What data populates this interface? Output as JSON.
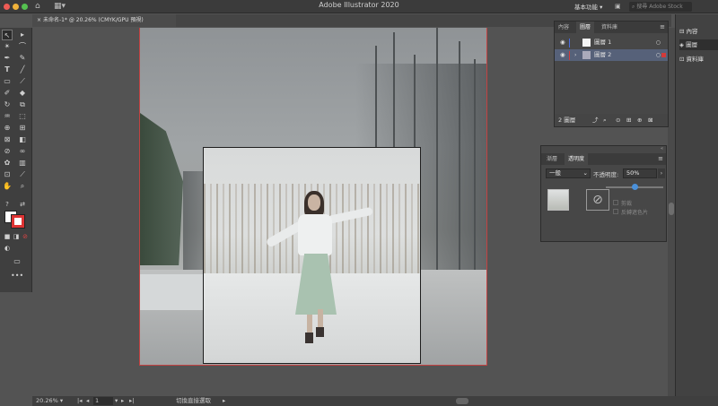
{
  "app": {
    "title": "Adobe Illustrator 2020",
    "workspace": "基本功能",
    "stock_placeholder": "搜尋 Adobe Stock",
    "colors": {
      "selection": "#566179",
      "artboard_border": "#c24242",
      "slider_accent": "#4a90d9"
    }
  },
  "tab": {
    "title": "未命名-1* @ 20.26% (CMYK/GPU 預視)",
    "close": "×"
  },
  "status": {
    "zoom": "20.26%",
    "page": "1",
    "message": "切換直接選取"
  },
  "layers_panel": {
    "tabs": [
      "內容",
      "圖層",
      "資料庫"
    ],
    "active_tab": 1,
    "layers": [
      {
        "name": "圖層 1",
        "selected": false,
        "color": "#4a6de0"
      },
      {
        "name": "圖層 2",
        "selected": true,
        "color": "#d23a3a"
      }
    ],
    "count": "2 圖層"
  },
  "transparency_panel": {
    "tabs": [
      "漸層",
      "透明度"
    ],
    "active_tab": 1,
    "blend_mode": "一般",
    "opacity_label": "不透明度:",
    "opacity_value": "50%",
    "opacity": 0.5,
    "clip_label": "剪裁",
    "invert_label": "反轉遮色片"
  },
  "right_dock": {
    "items": [
      "內容",
      "圖層",
      "資料庫"
    ]
  },
  "icons": {
    "home": "home-icon",
    "workspace": "grid-icon",
    "search": "search-icon"
  }
}
